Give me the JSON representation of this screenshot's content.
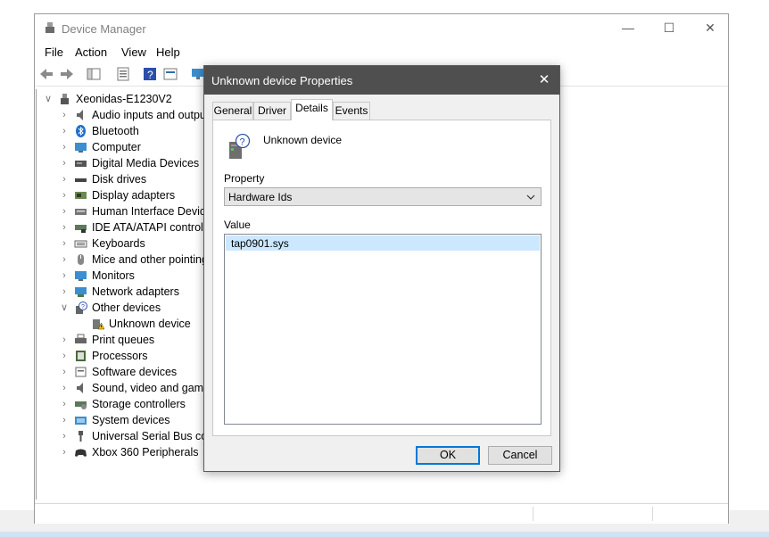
{
  "window": {
    "title": "Device Manager"
  },
  "menu": [
    "File",
    "Action",
    "View",
    "Help"
  ],
  "tree": {
    "root": "Xeonidas-E1230V2",
    "items": [
      "Audio inputs and outpu",
      "Bluetooth",
      "Computer",
      "Digital Media Devices",
      "Disk drives",
      "Display adapters",
      "Human Interface Device",
      "IDE ATA/ATAPI controlle",
      "Keyboards",
      "Mice and other pointing",
      "Monitors",
      "Network adapters",
      "Other devices",
      "Unknown device",
      "Print queues",
      "Processors",
      "Software devices",
      "Sound, video and game",
      "Storage controllers",
      "System devices",
      "Universal Serial Bus cont",
      "Xbox 360 Peripherals"
    ]
  },
  "dialog": {
    "title": "Unknown device Properties",
    "tabs": [
      "General",
      "Driver",
      "Details",
      "Events"
    ],
    "active_tab": "Details",
    "device_name": "Unknown device",
    "property_label": "Property",
    "property_value": "Hardware Ids",
    "value_label": "Value",
    "values": [
      "tap0901.sys"
    ],
    "ok_label": "OK",
    "cancel_label": "Cancel"
  },
  "colors": {
    "titlebar": "#4f4f4f",
    "accent": "#0078d7",
    "selection": "#cce8ff"
  }
}
